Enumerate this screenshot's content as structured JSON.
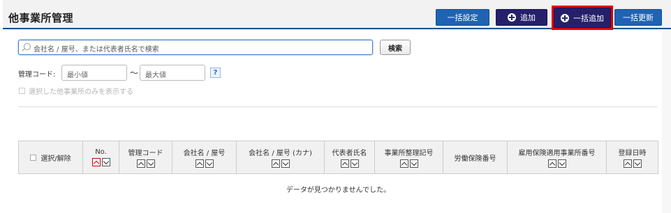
{
  "header": {
    "title": "他事業所管理",
    "buttons": {
      "bulk_settings": "一括設定",
      "add": "追加",
      "bulk_add": "一括追加",
      "bulk_update": "一括更新"
    }
  },
  "search": {
    "placeholder": "会社名 / 屋号、または代表者氏名で検索",
    "button": "検索"
  },
  "filter": {
    "management_code_label": "管理コード:",
    "min_placeholder": "最小値",
    "max_placeholder": "最大値",
    "separator": "〜",
    "help": "?",
    "only_selected_label": "選択した他事業所のみを表示する"
  },
  "table": {
    "columns": [
      {
        "label": "選択/解除"
      },
      {
        "label": "No."
      },
      {
        "label": "管理コード"
      },
      {
        "label": "会社名 / 屋号"
      },
      {
        "label": "会社名 / 屋号 (カナ)"
      },
      {
        "label": "代表者氏名"
      },
      {
        "label": "事業所整理記号"
      },
      {
        "label": "労働保険番号"
      },
      {
        "label": "雇用保険適用事業所番号"
      },
      {
        "label": "登録日時"
      }
    ],
    "empty_message": "データが見つかりませんでした。"
  },
  "colors": {
    "accent_blue": "#1f63b3",
    "navy": "#26206b",
    "highlight": "#e00000"
  }
}
